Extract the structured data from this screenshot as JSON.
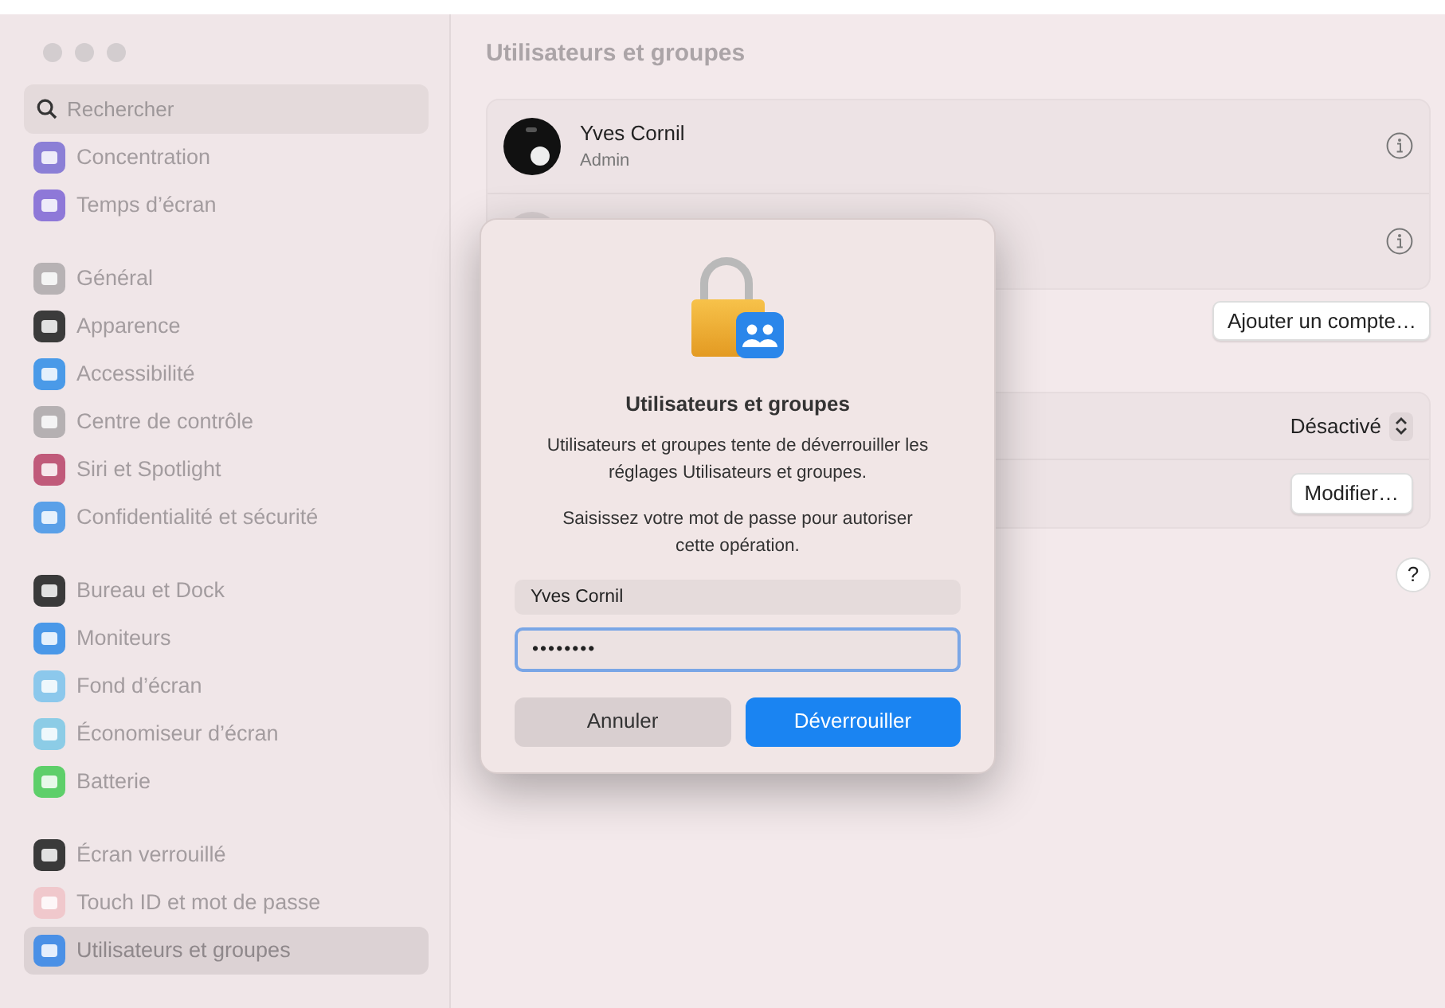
{
  "sidebar": {
    "search": {
      "placeholder": "Rechercher"
    },
    "groups": [
      {
        "items": [
          {
            "label": "Concentration",
            "color": "#8b7fd6",
            "selected": false
          },
          {
            "label": "Temps d’écran",
            "color": "#8e78d8",
            "selected": false
          }
        ]
      },
      {
        "items": [
          {
            "label": "Général",
            "color": "#b7b2b4",
            "selected": false
          },
          {
            "label": "Apparence",
            "color": "#3b3b3b",
            "selected": false
          },
          {
            "label": "Accessibilité",
            "color": "#4a9ae8",
            "selected": false
          },
          {
            "label": "Centre de contrôle",
            "color": "#b5b0b2",
            "selected": false
          },
          {
            "label": "Siri et Spotlight",
            "color": "#c05a7a",
            "selected": false
          },
          {
            "label": "Confidentialité et sécurité",
            "color": "#5aa0e8",
            "selected": false
          }
        ]
      },
      {
        "items": [
          {
            "label": "Bureau et Dock",
            "color": "#3a3a3a",
            "selected": false
          },
          {
            "label": "Moniteurs",
            "color": "#4a98e8",
            "selected": false
          },
          {
            "label": "Fond d’écran",
            "color": "#8cc8ec",
            "selected": false
          },
          {
            "label": "Économiseur d’écran",
            "color": "#8ccce6",
            "selected": false
          },
          {
            "label": "Batterie",
            "color": "#5ecf6a",
            "selected": false
          }
        ]
      },
      {
        "items": [
          {
            "label": "Écran verrouillé",
            "color": "#3a3a3a",
            "selected": false
          },
          {
            "label": "Touch ID et mot de passe",
            "color": "#f0c8cc",
            "selected": false
          },
          {
            "label": "Utilisateurs et groupes",
            "color": "#4a90e6",
            "selected": true
          }
        ]
      }
    ]
  },
  "main": {
    "title": "Utilisateurs et groupes",
    "users": [
      {
        "kind": "photo",
        "name": "Yves Cornil",
        "role": "Admin"
      },
      {
        "kind": "blank"
      }
    ],
    "add_account_button": "Ajouter un compte…",
    "settings": [
      {
        "kind": "select",
        "value": "Désactivé"
      },
      {
        "kind": "button",
        "label": "Modifier…"
      }
    ],
    "help_button": "?"
  },
  "dialog": {
    "title": "Utilisateurs et groupes",
    "message": "Utilisateurs et groupes tente de déverrouiller les réglages Utilisateurs et groupes.",
    "prompt": "Saisissez votre mot de passe pour autoriser cette opération.",
    "username": "Yves Cornil",
    "password": "••••••••",
    "buttons": [
      {
        "label": "Annuler",
        "default": false
      },
      {
        "label": "Déverrouiller",
        "default": true
      }
    ]
  }
}
